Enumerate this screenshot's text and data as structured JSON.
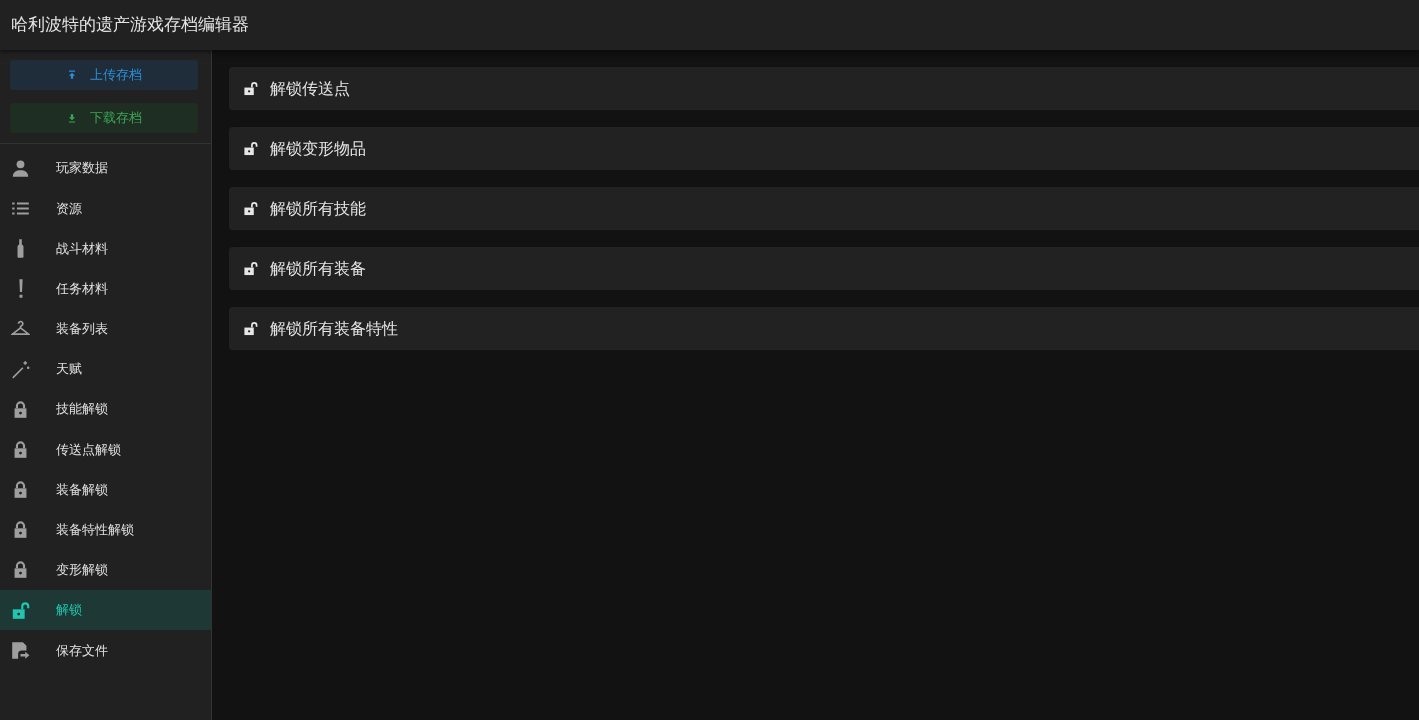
{
  "header": {
    "title": "哈利波特的遗产游戏存档编辑器"
  },
  "actions": [
    {
      "label": "上传存档",
      "kind": "upload"
    },
    {
      "label": "下载存档",
      "kind": "download"
    }
  ],
  "sidebar": {
    "items": [
      {
        "label": "玩家数据",
        "kind": "person",
        "selected": false
      },
      {
        "label": "资源",
        "kind": "list",
        "selected": false
      },
      {
        "label": "战斗材料",
        "kind": "bottle",
        "selected": false
      },
      {
        "label": "任务材料",
        "kind": "exclaim",
        "selected": false
      },
      {
        "label": "装备列表",
        "kind": "hanger",
        "selected": false
      },
      {
        "label": "天赋",
        "kind": "wand",
        "selected": false
      },
      {
        "label": "技能解锁",
        "kind": "lock",
        "selected": false
      },
      {
        "label": "传送点解锁",
        "kind": "lock",
        "selected": false
      },
      {
        "label": "装备解锁",
        "kind": "lock",
        "selected": false
      },
      {
        "label": "装备特性解锁",
        "kind": "lock",
        "selected": false
      },
      {
        "label": "变形解锁",
        "kind": "lock",
        "selected": false
      },
      {
        "label": "解锁",
        "kind": "unlock",
        "selected": true
      },
      {
        "label": "保存文件",
        "kind": "save",
        "selected": false
      }
    ]
  },
  "panels": [
    {
      "label": "解锁传送点"
    },
    {
      "label": "解锁变形物品"
    },
    {
      "label": "解锁所有技能"
    },
    {
      "label": "解锁所有装备"
    },
    {
      "label": "解锁所有装备特性"
    }
  ]
}
